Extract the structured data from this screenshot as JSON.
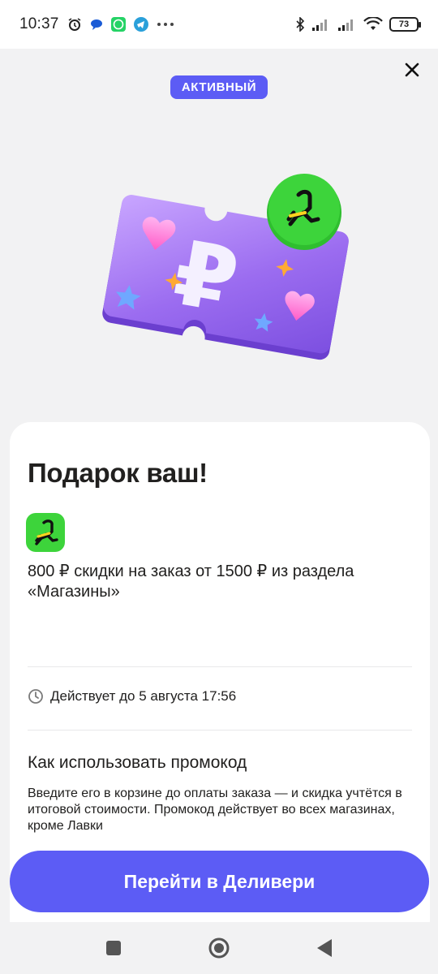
{
  "status_bar": {
    "time": "10:37",
    "battery": "73",
    "left_icons": [
      "alarm-icon",
      "chat-icon",
      "whatsapp-icon",
      "telegram-icon",
      "more-dots-icon"
    ],
    "right_icons": [
      "bluetooth-icon",
      "signal-icon",
      "signal-icon",
      "wifi-icon",
      "battery-icon"
    ]
  },
  "badge": "АКТИВНЫЙ",
  "close_icon": "close-icon",
  "card": {
    "title": "Подарок ваш!",
    "offer": "800 ₽ скидки на заказ от 1500 ₽ из раздела «Магазины»",
    "validity": "Действует до 5 августа 17:56",
    "howto_title": "Как использовать промокод",
    "howto_text": "Введите его в корзине до оплаты заказа — и скидка учтётся в итоговой стоимости. Промокод действует во всех магазинах, кроме Лавки"
  },
  "cta": "Перейти в Деливери",
  "colors": {
    "accent": "#5c5cf5",
    "partner_green": "#3dd43b",
    "ticket_purple": "#9b6cf0",
    "background": "#f2f2f3"
  },
  "nav": [
    "recent-apps-icon",
    "home-icon",
    "back-icon"
  ]
}
